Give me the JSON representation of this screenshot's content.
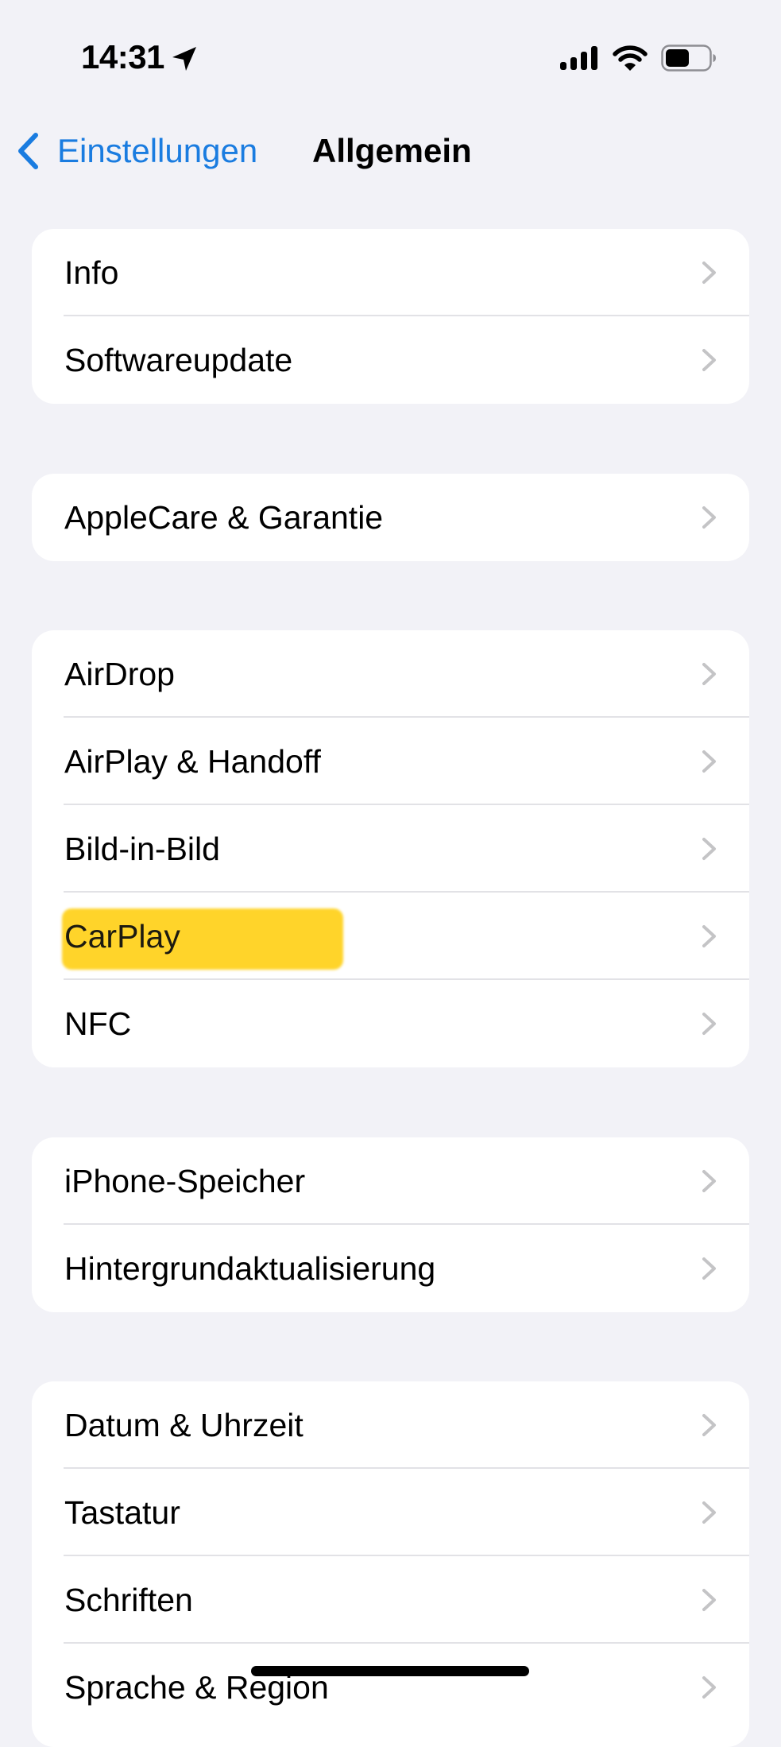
{
  "status_bar": {
    "time": "14:31",
    "location_icon": "location-arrow-icon",
    "signal_icon": "cellular-signal-icon",
    "wifi_icon": "wifi-icon",
    "battery_icon": "battery-icon",
    "battery_level_fraction": 0.55
  },
  "nav": {
    "back_label": "Einstellungen",
    "back_icon": "chevron-left-icon",
    "title": "Allgemein"
  },
  "colors": {
    "accent": "#1A7CE0",
    "background": "#F2F2F7",
    "card": "#FFFFFF",
    "separator": "#E2E2E6",
    "chevron": "#C4C4C6",
    "highlight": "#FFD42A"
  },
  "groups": [
    {
      "items": [
        {
          "label": "Info"
        },
        {
          "label": "Softwareupdate"
        }
      ]
    },
    {
      "items": [
        {
          "label": "AppleCare & Garantie"
        }
      ]
    },
    {
      "items": [
        {
          "label": "AirDrop"
        },
        {
          "label": "AirPlay & Handoff"
        },
        {
          "label": "Bild-in-Bild"
        },
        {
          "label": "CarPlay",
          "highlighted": true
        },
        {
          "label": "NFC"
        }
      ]
    },
    {
      "items": [
        {
          "label": "iPhone-Speicher"
        },
        {
          "label": "Hintergrundaktualisierung"
        }
      ]
    },
    {
      "items": [
        {
          "label": "Datum & Uhrzeit"
        },
        {
          "label": "Tastatur"
        },
        {
          "label": "Schriften"
        },
        {
          "label": "Sprache & Region"
        }
      ]
    }
  ]
}
